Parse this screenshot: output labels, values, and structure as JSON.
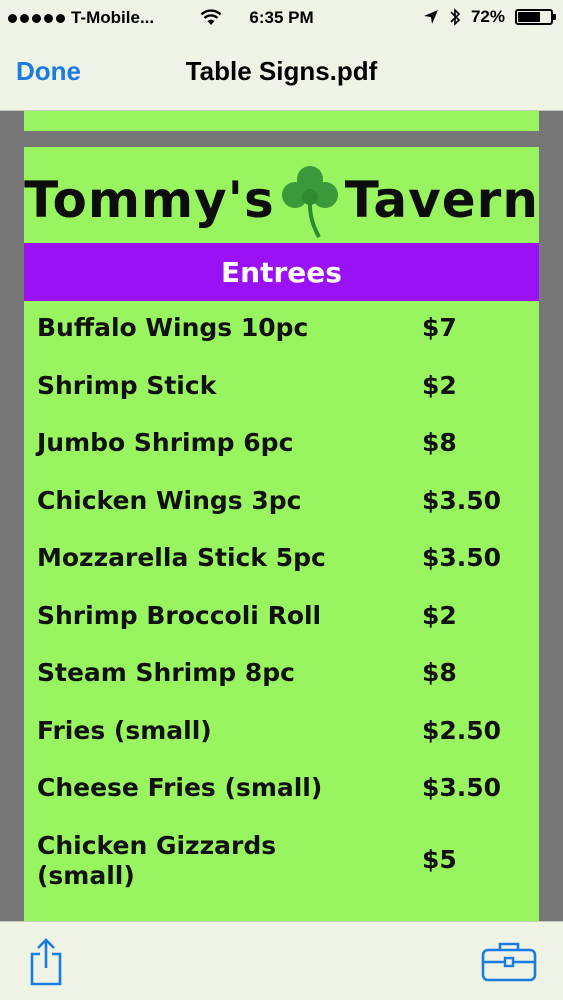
{
  "status_bar": {
    "carrier": "T-Mobile...",
    "time": "6:35 PM",
    "battery": "72%",
    "battery_level": 0.72
  },
  "nav": {
    "done_label": "Done",
    "title": "Table Signs.pdf"
  },
  "page": {
    "logo_left": "Tommy's",
    "logo_right": "Tavern",
    "section_title": "Entrees",
    "items": [
      {
        "name": "Buffalo Wings 10pc",
        "price": "$7"
      },
      {
        "name": "Shrimp Stick",
        "price": "$2"
      },
      {
        "name": "Jumbo Shrimp 6pc",
        "price": "$8"
      },
      {
        "name": "Chicken Wings 3pc",
        "price": "$3.50"
      },
      {
        "name": "Mozzarella Stick 5pc",
        "price": "$3.50"
      },
      {
        "name": "Shrimp Broccoli Roll",
        "price": "$2"
      },
      {
        "name": "Steam Shrimp 8pc",
        "price": "$8"
      },
      {
        "name": "Fries (small)",
        "price": "$2.50"
      },
      {
        "name": "Cheese Fries (small)",
        "price": "$3.50"
      },
      {
        "name": "Chicken Gizzards (small)",
        "price": "$5"
      }
    ]
  },
  "colors": {
    "page_green": "#98f55f",
    "section_purple": "#9b11f5",
    "ios_blue": "#1a7be0",
    "shamrock_green": "#3a9a3a"
  },
  "icons": {
    "signal": "signal-dots-icon",
    "wifi": "wifi-icon",
    "location": "location-arrow-icon",
    "bluetooth": "bluetooth-icon",
    "battery": "battery-icon",
    "shamrock": "shamrock-icon",
    "share": "share-icon",
    "markup": "toolbox-icon"
  }
}
